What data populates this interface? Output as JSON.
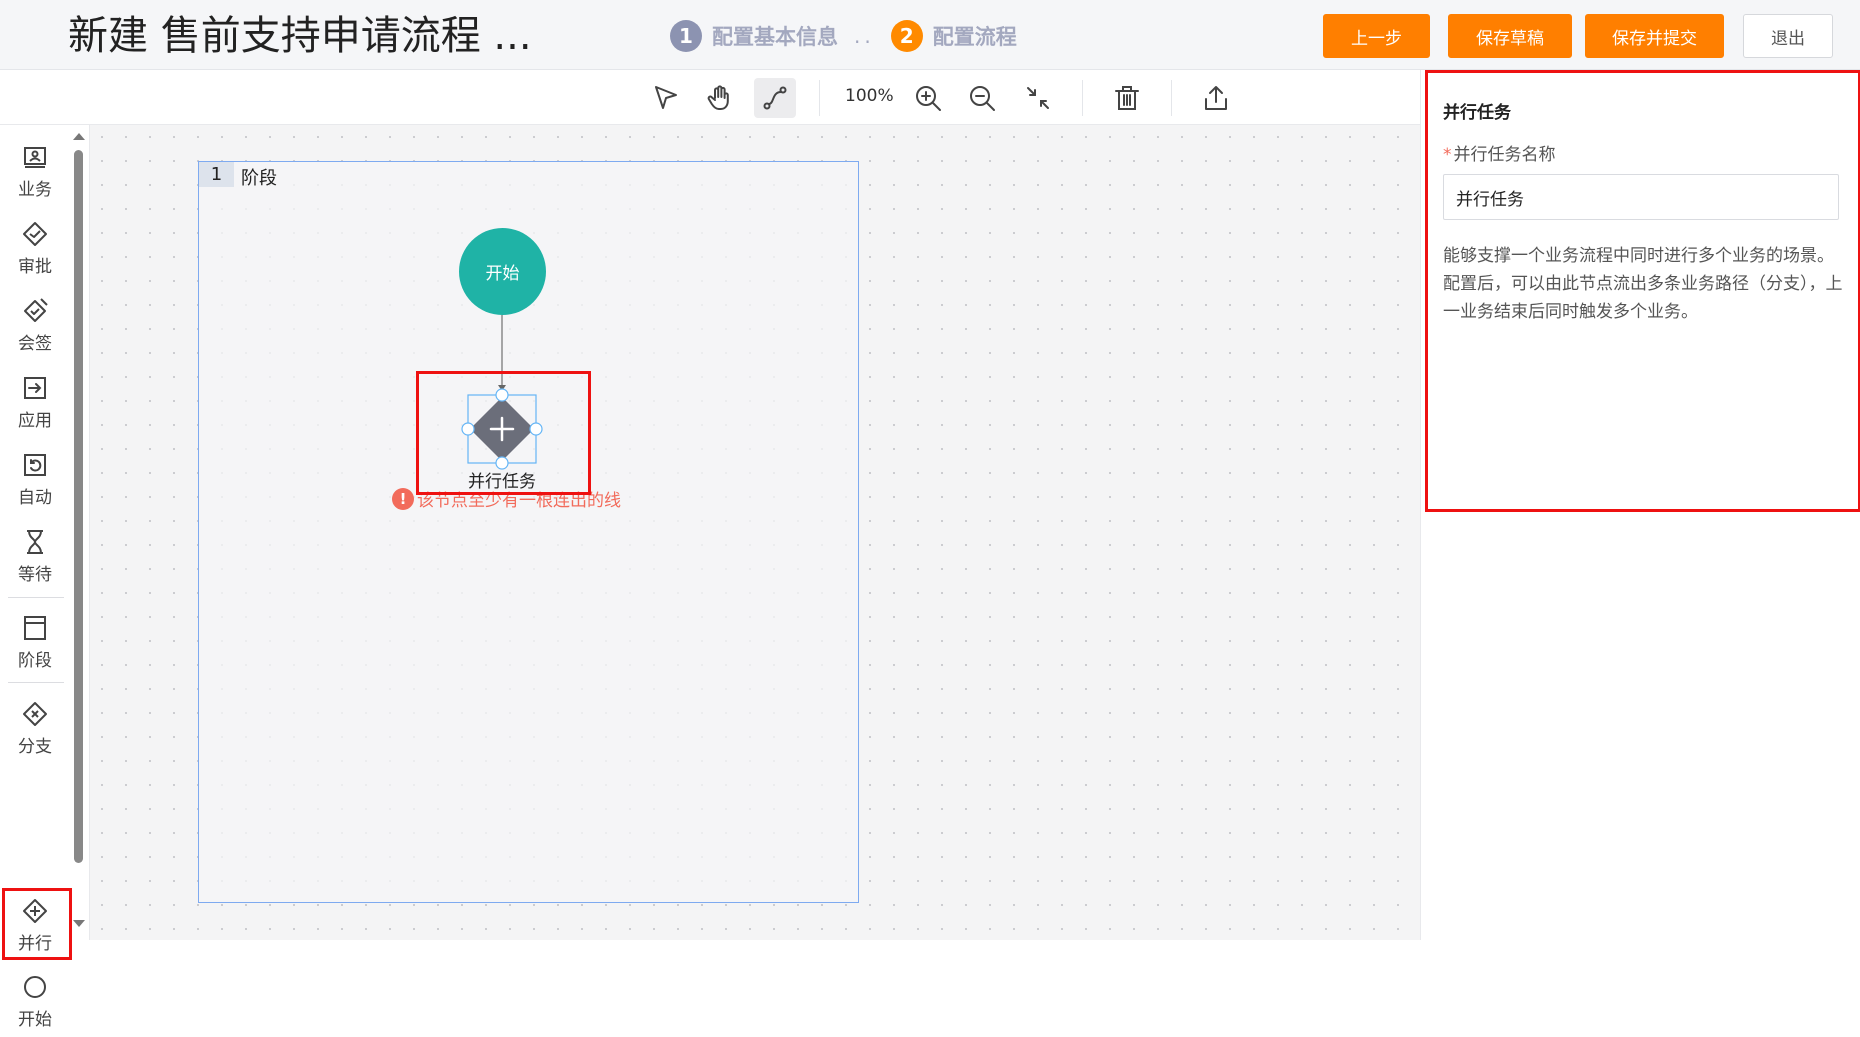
{
  "header": {
    "title": "新建 售前支持申请流程 ...",
    "steps": [
      {
        "num": "1",
        "label": "配置基本信息"
      },
      {
        "num": "2",
        "label": "配置流程"
      }
    ],
    "step_separator": "..",
    "buttons": {
      "prev": "上一步",
      "save_draft": "保存草稿",
      "save_submit": "保存并提交",
      "exit": "退出"
    }
  },
  "toolbar": {
    "zoom": "100%",
    "tools": [
      "select-pointer-icon",
      "hand-pan-icon",
      "connect-line-icon",
      "zoom-in-icon",
      "zoom-out-icon",
      "fit-view-icon",
      "trash-icon",
      "export-icon"
    ]
  },
  "palette": {
    "items": [
      {
        "label": "业务",
        "icon": "business-icon"
      },
      {
        "label": "审批",
        "icon": "approval-icon"
      },
      {
        "label": "会签",
        "icon": "countersign-icon"
      },
      {
        "label": "应用",
        "icon": "application-icon"
      },
      {
        "label": "自动",
        "icon": "auto-icon"
      },
      {
        "label": "等待",
        "icon": "hourglass-icon"
      },
      {
        "label": "阶段",
        "icon": "stage-icon"
      },
      {
        "label": "分支",
        "icon": "branch-icon"
      },
      {
        "label": "并行",
        "icon": "parallel-icon"
      },
      {
        "label": "开始",
        "icon": "start-circle-icon"
      }
    ]
  },
  "canvas": {
    "stage": {
      "num": "1",
      "name": "阶段"
    },
    "start_node": "开始",
    "parallel_node": "并行任务",
    "warning": "该节点至少有一根连出的线"
  },
  "panel": {
    "title": "并行任务",
    "field_required_mark": "*",
    "field_label": "并行任务名称",
    "field_value": "并行任务",
    "description": "能够支撑一个业务流程中同时进行多个业务的场景。配置后，可以由此节点流出多条业务路径（分支），上一业务结束后同时触发多个业务。"
  },
  "colors": {
    "accent_orange": "#ff7f00",
    "start_node": "#1fb3a6",
    "parallel_node": "#6b6e7a",
    "highlight_red": "#e11111",
    "warning": "#f26b5b"
  }
}
